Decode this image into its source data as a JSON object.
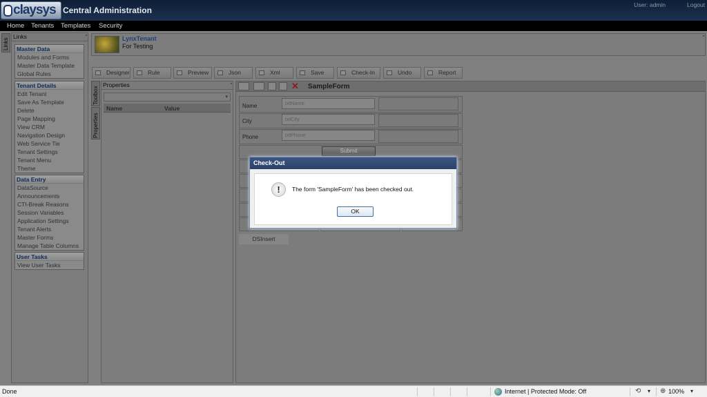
{
  "header": {
    "logo_text": "claysys",
    "app_title": "Central Administration",
    "user": "User: admin",
    "logout": "Logout"
  },
  "menu": [
    "Home",
    "Tenants",
    "Templates",
    "Security"
  ],
  "links_tab": "Links",
  "links_panel": {
    "title": "Links",
    "groups": [
      {
        "title": "Master Data",
        "items": [
          "Modules and Forms",
          "Master Data Template",
          "Global Rules"
        ]
      },
      {
        "title": "Tenant Details",
        "items": [
          "Edit Tenant",
          "Save As Template",
          "Delete",
          "Page Mapping",
          "View CRM",
          "Navigation Design",
          "Web Service Tie",
          "Tenant Settings",
          "Tenant Menu",
          "Theme"
        ]
      },
      {
        "title": "Data Entry",
        "items": [
          "DataSource",
          "Announcements",
          "CTI-Break Reasons",
          "Session Variables",
          "Application Settings",
          "Tenant Alerts",
          "Master Forms",
          "Manage Table Columns"
        ]
      },
      {
        "title": "User Tasks",
        "items": [
          "View User Tasks"
        ]
      }
    ]
  },
  "tenant": {
    "name": "LynxTenant",
    "description": "For Testing"
  },
  "toolbar": [
    "Designer",
    "Rule",
    "Preview",
    "Json",
    "Xml",
    "Save",
    "Check-In",
    "Undo",
    "Report"
  ],
  "side_tabs": [
    "Toolbox",
    "Properties"
  ],
  "properties": {
    "title": "Properties",
    "columns": [
      "Name",
      "Value"
    ]
  },
  "form": {
    "title": "SampleForm",
    "fields": [
      {
        "label": "Name",
        "placeholder": "txtName"
      },
      {
        "label": "City",
        "placeholder": "txtCity"
      },
      {
        "label": "Phone",
        "placeholder": "txtPhone"
      }
    ],
    "submit": "Submit",
    "ds_insert": "DSInsert"
  },
  "dialog": {
    "title": "Check-Out",
    "message": "The form 'SampleForm' has been checked out.",
    "ok": "OK",
    "icon": "exclamation-icon"
  },
  "statusbar": {
    "left": "Done",
    "zone": "Internet | Protected Mode: Off",
    "zoom": "100%"
  }
}
